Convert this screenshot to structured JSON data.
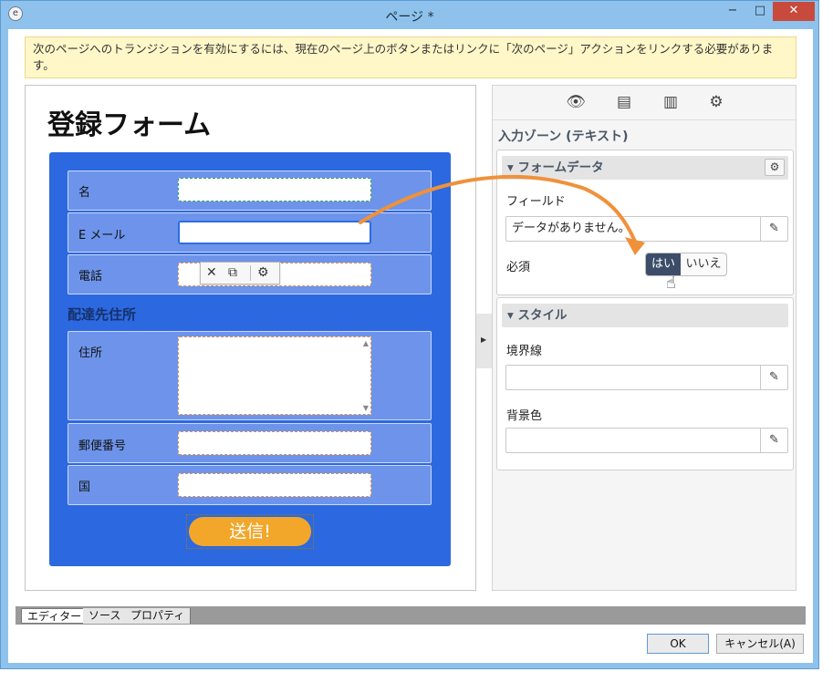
{
  "window": {
    "title": "ページ *",
    "app_icon": "app-logo-icon",
    "minimize": "−",
    "maximize": "□",
    "close": "✕"
  },
  "info_message": "次のページへのトランジションを有効にするには、現在のページ上のボタンまたはリンクに「次のページ」アクションをリンクする必要があります。",
  "editor": {
    "form_title": "登録フォーム",
    "fields": [
      {
        "label": "名"
      },
      {
        "label": "E メール"
      },
      {
        "label": "電話"
      }
    ],
    "section_title": "配達先住所",
    "address_fields": [
      {
        "label": "住所"
      },
      {
        "label": "郵便番号"
      },
      {
        "label": "国"
      }
    ],
    "submit_label": "送信!",
    "field_toolbar_icons": [
      "cut-icon",
      "copy-icon",
      "gear-icon"
    ]
  },
  "props": {
    "toolbar_icons": [
      "preview-icon",
      "page-up-icon",
      "page-copy-icon",
      "page-settings-icon"
    ],
    "heading": "入力ゾーン (テキスト)",
    "form_data": {
      "header": "フォームデータ",
      "field_label": "フィールド",
      "field_value": "データがありません。",
      "required_label": "必須",
      "required_yes": "はい",
      "required_no": "いいえ",
      "required_selected": "はい"
    },
    "style": {
      "header": "スタイル",
      "border_label": "境界線",
      "border_value": "",
      "background_label": "背景色",
      "background_value": ""
    }
  },
  "tabs": [
    {
      "label": "エディター",
      "active": true
    },
    {
      "label": "ソース",
      "active": false
    },
    {
      "label": "プロパティ",
      "active": false
    }
  ],
  "buttons": {
    "ok": "OK",
    "cancel": "キャンセル(A)"
  },
  "colors": {
    "form_panel": "#2c69e0",
    "submit": "#f2a72b",
    "arrow": "#f0913a",
    "info_bg": "#fff7c8"
  }
}
